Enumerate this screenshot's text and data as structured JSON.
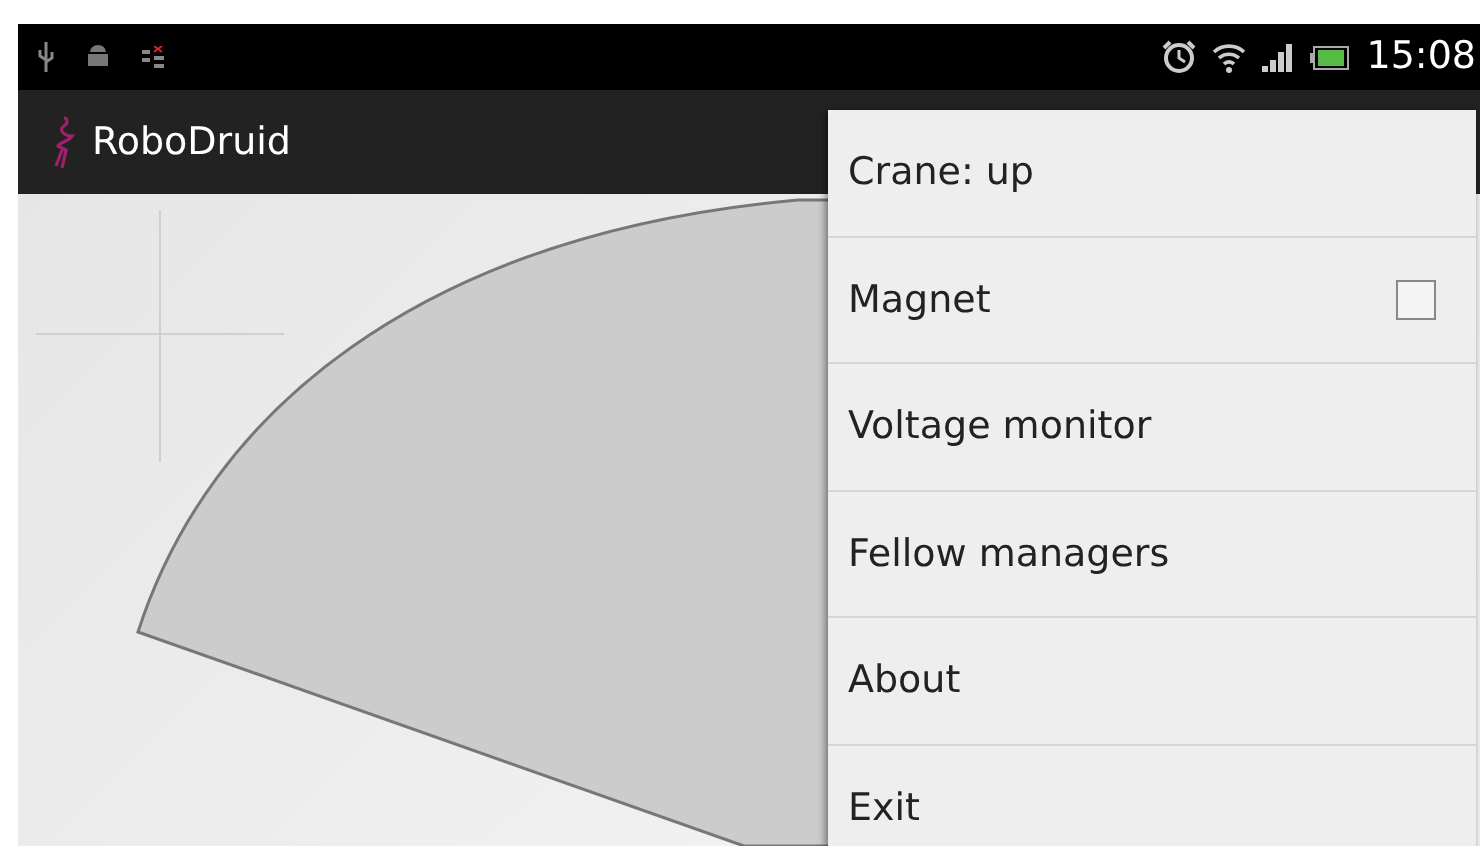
{
  "status_bar": {
    "time": "15:08"
  },
  "app_bar": {
    "title": "RoboDruid"
  },
  "menu": [
    {
      "kind": "text",
      "label": "Crane: up"
    },
    {
      "kind": "checkbox",
      "label": "Magnet",
      "checked": false
    },
    {
      "kind": "text",
      "label": "Voltage monitor"
    },
    {
      "kind": "text",
      "label": "Fellow managers"
    },
    {
      "kind": "text",
      "label": "About"
    },
    {
      "kind": "text",
      "label": "Exit"
    }
  ]
}
